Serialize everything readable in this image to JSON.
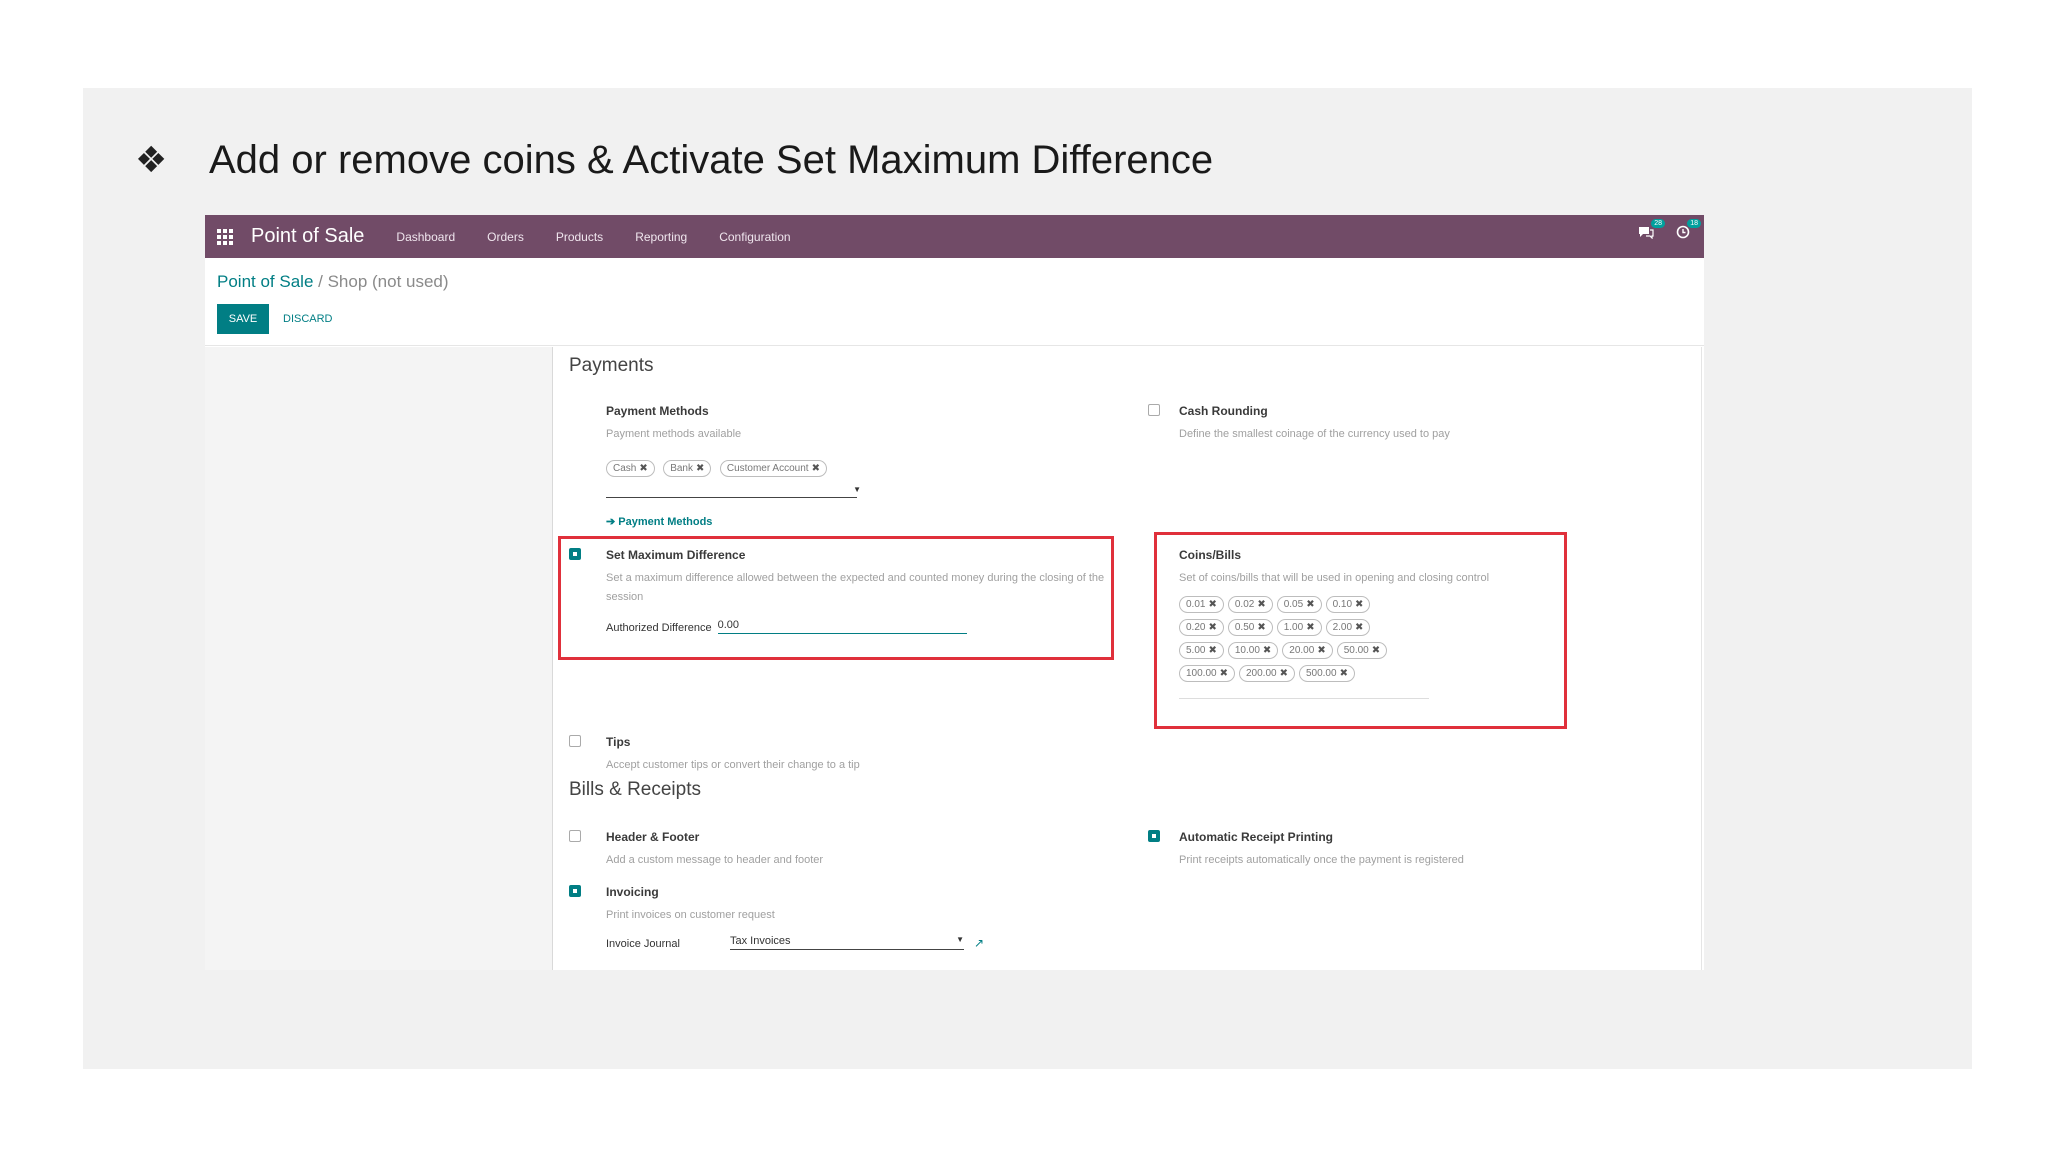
{
  "slide": {
    "bullet_icon": "four-diamond-bullet-icon",
    "bullet_glyph": "❖",
    "heading": "Add or remove coins & Activate Set Maximum Difference"
  },
  "navbar": {
    "color": "#714b67",
    "app_title": "Point of Sale",
    "menu": [
      "Dashboard",
      "Orders",
      "Products",
      "Reporting",
      "Configuration"
    ],
    "messages_badge": "28",
    "activity_badge": "18"
  },
  "breadcrumb": {
    "parent": "Point of Sale",
    "separator": " / ",
    "current": "Shop (not used)"
  },
  "buttons": {
    "save": "SAVE",
    "discard": "DISCARD"
  },
  "payments": {
    "title": "Payments",
    "payment_methods": {
      "title": "Payment Methods",
      "desc": "Payment methods available",
      "tags": [
        "Cash",
        "Bank",
        "Customer Account"
      ],
      "link": "Payment Methods"
    },
    "cash_rounding": {
      "title": "Cash Rounding",
      "desc": "Define the smallest coinage of the currency used to pay",
      "checked": false
    },
    "max_difference": {
      "title": "Set Maximum Difference",
      "desc": "Set a maximum difference allowed between the expected and counted money during the closing of the session",
      "field_label": "Authorized Difference",
      "field_value": "0.00",
      "checked": true
    },
    "coins_bills": {
      "title": "Coins/Bills",
      "desc": "Set of coins/bills that will be used in opening and closing control",
      "rows": [
        [
          "0.01",
          "0.02",
          "0.05",
          "0.10"
        ],
        [
          "0.20",
          "0.50",
          "1.00",
          "2.00"
        ],
        [
          "5.00",
          "10.00",
          "20.00",
          "50.00"
        ],
        [
          "100.00",
          "200.00",
          "500.00"
        ]
      ]
    },
    "tips": {
      "title": "Tips",
      "desc": "Accept customer tips or convert their change to a tip",
      "checked": false
    }
  },
  "bills_receipts": {
    "title": "Bills & Receipts",
    "header_footer": {
      "title": "Header & Footer",
      "desc": "Add a custom message to header and footer",
      "checked": false
    },
    "auto_receipt": {
      "title": "Automatic Receipt Printing",
      "desc": "Print receipts automatically once the payment is registered",
      "checked": true
    },
    "invoicing": {
      "title": "Invoicing",
      "desc": "Print invoices on customer request",
      "field_label": "Invoice Journal",
      "field_value": "Tax Invoices",
      "checked": true
    }
  },
  "colors": {
    "accent": "#017e84",
    "highlight": "#e0303b"
  }
}
